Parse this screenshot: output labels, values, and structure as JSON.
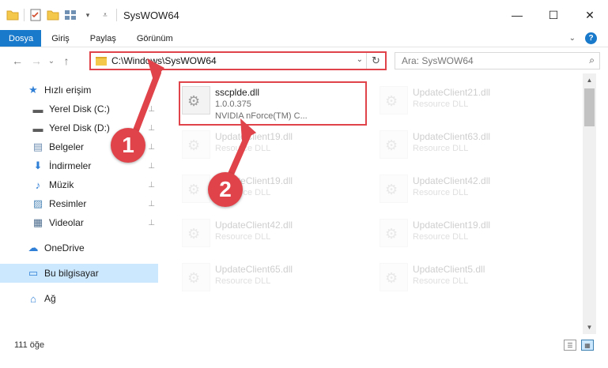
{
  "window": {
    "title": "SysWOW64",
    "controls": {
      "minimize": "—",
      "maximize": "☐",
      "close": "✕"
    }
  },
  "ribbon": {
    "tabs": [
      "Dosya",
      "Giriş",
      "Paylaş",
      "Görünüm"
    ],
    "active_tab": "Dosya"
  },
  "nav": {
    "back": "←",
    "forward": "→",
    "recent": "⌄",
    "up": "↑",
    "address": "C:\\Windows\\SysWOW64",
    "dropdown": "⌄",
    "refresh": "↻",
    "search_placeholder": "Ara: SysWOW64",
    "search_icon": "⌕"
  },
  "sidebar": {
    "items": [
      {
        "label": "Hızlı erişim",
        "icon": "star-icon",
        "glyph": "★",
        "color": "#2f7fd6",
        "pinned": false
      },
      {
        "label": "Yerel Disk (C:)",
        "icon": "drive-icon",
        "glyph": "▬",
        "color": "#5b5b5b",
        "pinned": true
      },
      {
        "label": "Yerel Disk (D:)",
        "icon": "drive-icon",
        "glyph": "▬",
        "color": "#5b5b5b",
        "pinned": true
      },
      {
        "label": "Belgeler",
        "icon": "documents-icon",
        "glyph": "▤",
        "color": "#6f8fb3",
        "pinned": true
      },
      {
        "label": "İndirmeler",
        "icon": "download-icon",
        "glyph": "⬇",
        "color": "#2f7fd6",
        "pinned": true
      },
      {
        "label": "Müzik",
        "icon": "music-icon",
        "glyph": "♪",
        "color": "#2f7fd6",
        "pinned": true
      },
      {
        "label": "Resimler",
        "icon": "pictures-icon",
        "glyph": "▨",
        "color": "#4f88b8",
        "pinned": true
      },
      {
        "label": "Videolar",
        "icon": "video-icon",
        "glyph": "▦",
        "color": "#4f6f8f",
        "pinned": true
      },
      {
        "label": "OneDrive",
        "icon": "cloud-icon",
        "glyph": "☁",
        "color": "#2f7fd6",
        "pinned": false
      },
      {
        "label": "Bu bilgisayar",
        "icon": "computer-icon",
        "glyph": "▭",
        "color": "#2f7fd6",
        "pinned": false
      },
      {
        "label": "Ağ",
        "icon": "network-icon",
        "glyph": "⌂",
        "color": "#2f7fd6",
        "pinned": false
      }
    ],
    "selected": "Bu bilgisayar",
    "pin_glyph": "📌"
  },
  "files": [
    {
      "name": "sscplde.dll",
      "version": "1.0.0.375",
      "desc": "NVIDIA nForce(TM) C...",
      "highlighted": true
    },
    {
      "name": "UpdateClient21.dll",
      "desc": "Resource DLL"
    },
    {
      "name": "UpdateClient19.dll",
      "desc": "Resource DLL"
    },
    {
      "name": "UpdateClient63.dll",
      "desc": "Resource DLL"
    },
    {
      "name": "UpdateClient19.dll",
      "desc": "Resource DLL"
    },
    {
      "name": "UpdateClient42.dll",
      "desc": "Resource DLL"
    },
    {
      "name": "UpdateClient42.dll",
      "desc": "Resource DLL"
    },
    {
      "name": "UpdateClient19.dll",
      "desc": "Resource DLL"
    },
    {
      "name": "UpdateClient65.dll",
      "desc": "Resource DLL"
    },
    {
      "name": "UpdateClient5.dll",
      "desc": "Resource DLL"
    }
  ],
  "status": {
    "count": "111 öğe"
  },
  "callouts": [
    "1",
    "2"
  ],
  "colors": {
    "accent": "#1979ca",
    "highlight": "#e0434a",
    "selected": "#cce8ff"
  }
}
